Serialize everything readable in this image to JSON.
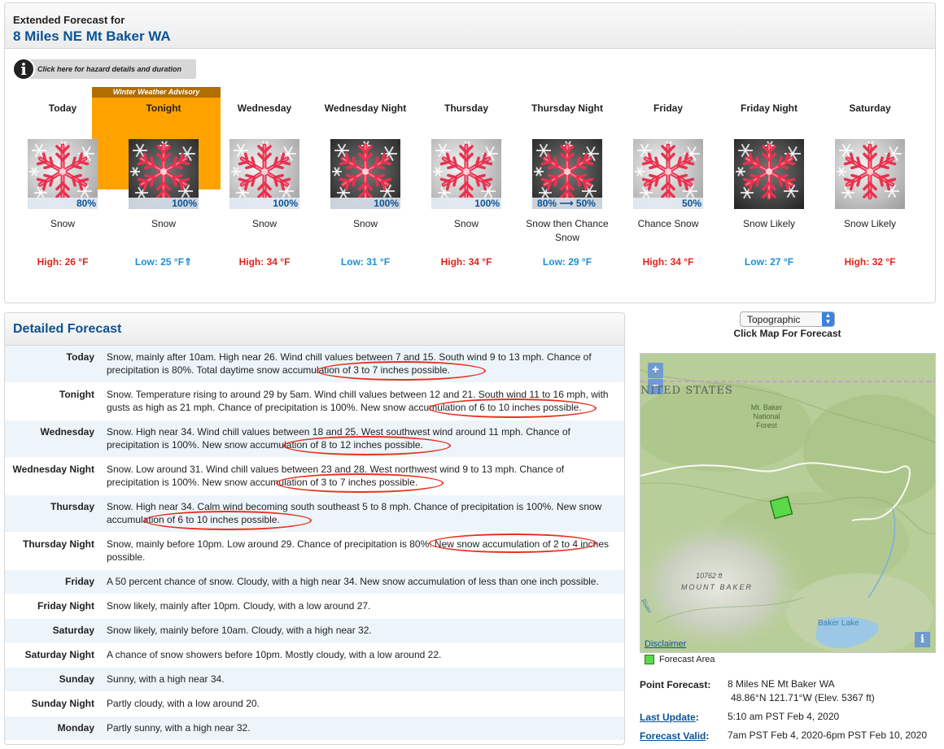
{
  "header": {
    "label": "Extended Forecast for",
    "location": "8 Miles NE Mt Baker WA"
  },
  "hazard": {
    "text": "Click here for hazard details and duration"
  },
  "advisory": {
    "text": "Winter Weather Advisory"
  },
  "periods": [
    {
      "name": "Today",
      "pop": "80%",
      "desc": "Snow",
      "temp": "High: 26 °F"
    },
    {
      "name": "Tonight",
      "pop": "100%",
      "desc": "Snow",
      "temp": "Low: 25 °F⇑"
    },
    {
      "name": "Wednesday",
      "pop": "100%",
      "desc": "Snow",
      "temp": "High: 34 °F"
    },
    {
      "name": "Wednesday Night",
      "pop": "100%",
      "desc": "Snow",
      "temp": "Low: 31 °F"
    },
    {
      "name": "Thursday",
      "pop": "100%",
      "desc": "Snow",
      "temp": "High: 34 °F"
    },
    {
      "name": "Thursday Night",
      "pop": "80% ⟶ 50%",
      "desc": "Snow then Chance Snow",
      "temp": "Low: 29 °F"
    },
    {
      "name": "Friday",
      "pop": "50%",
      "desc": "Chance Snow",
      "temp": "High: 34 °F"
    },
    {
      "name": "Friday Night",
      "pop": "",
      "desc": "Snow Likely",
      "temp": "Low: 27 °F"
    },
    {
      "name": "Saturday",
      "pop": "",
      "desc": "Snow Likely",
      "temp": "High: 32 °F"
    }
  ],
  "detail": {
    "title": "Detailed Forecast",
    "rows": [
      {
        "k": "Today",
        "v": "Snow, mainly after 10am. High near 26. Wind chill values between 7 and 15. South wind 9 to 13 mph. Chance of precipitation is 80%. Total daytime snow accumulation of 3 to 7 inches possible."
      },
      {
        "k": "Tonight",
        "v": "Snow. Temperature rising to around 29 by 5am. Wind chill values between 12 and 21. South wind 11 to 16 mph, with gusts as high as 21 mph. Chance of precipitation is 100%. New snow accumulation of 6 to 10 inches possible."
      },
      {
        "k": "Wednesday",
        "v": "Snow. High near 34. Wind chill values between 18 and 25. West southwest wind around 11 mph. Chance of precipitation is 100%. New snow accumulation of 8 to 12 inches possible."
      },
      {
        "k": "Wednesday Night",
        "v": "Snow. Low around 31. Wind chill values between 23 and 28. West northwest wind 9 to 13 mph. Chance of precipitation is 100%. New snow accumulation of 3 to 7 inches possible."
      },
      {
        "k": "Thursday",
        "v": "Snow. High near 34. Calm wind becoming south southeast 5 to 8 mph. Chance of precipitation is 100%. New snow accumulation of 6 to 10 inches possible."
      },
      {
        "k": "Thursday Night",
        "v": "Snow, mainly before 10pm. Low around 29. Chance of precipitation is 80%. New snow accumulation of 2 to 4 inches possible."
      },
      {
        "k": "Friday",
        "v": "A 50 percent chance of snow. Cloudy, with a high near 34. New snow accumulation of less than one inch possible."
      },
      {
        "k": "Friday Night",
        "v": "Snow likely, mainly after 10pm. Cloudy, with a low around 27."
      },
      {
        "k": "Saturday",
        "v": "Snow likely, mainly before 10am. Cloudy, with a high near 32."
      },
      {
        "k": "Saturday Night",
        "v": "A chance of snow showers before 10pm. Mostly cloudy, with a low around 22."
      },
      {
        "k": "Sunday",
        "v": "Sunny, with a high near 34."
      },
      {
        "k": "Sunday Night",
        "v": "Partly cloudy, with a low around 20."
      },
      {
        "k": "Monday",
        "v": "Partly sunny, with a high near 32."
      }
    ]
  },
  "map": {
    "select": "Topographic",
    "caption": "Click Map For Forecast",
    "country": "NITED STATES",
    "forest": "Mt. Baker National Forest",
    "peak_elev": "10762 ft",
    "peak_name": "MOUNT BAKER",
    "lake": "Baker Lake",
    "river": "River",
    "disclaimer": "Disclaimer",
    "legend": "Forecast Area"
  },
  "point": {
    "label": "Point Forecast:",
    "loc": "8 Miles NE Mt Baker WA",
    "coords": "48.86°N 121.71°W (Elev. 5367 ft)",
    "update_label": "Last Update",
    "update_val": "5:10 am PST Feb 4, 2020",
    "valid_label": "Forecast Valid",
    "valid_val": "7am PST Feb 4, 2020-6pm PST Feb 10, 2020"
  }
}
